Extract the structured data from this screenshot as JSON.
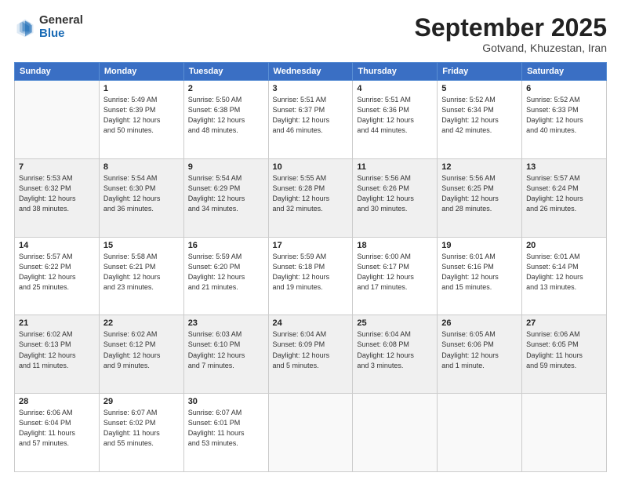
{
  "header": {
    "logo_general": "General",
    "logo_blue": "Blue",
    "title": "September 2025",
    "subtitle": "Gotvand, Khuzestan, Iran"
  },
  "weekdays": [
    "Sunday",
    "Monday",
    "Tuesday",
    "Wednesday",
    "Thursday",
    "Friday",
    "Saturday"
  ],
  "weeks": [
    [
      {
        "day": "",
        "info": ""
      },
      {
        "day": "1",
        "info": "Sunrise: 5:49 AM\nSunset: 6:39 PM\nDaylight: 12 hours\nand 50 minutes."
      },
      {
        "day": "2",
        "info": "Sunrise: 5:50 AM\nSunset: 6:38 PM\nDaylight: 12 hours\nand 48 minutes."
      },
      {
        "day": "3",
        "info": "Sunrise: 5:51 AM\nSunset: 6:37 PM\nDaylight: 12 hours\nand 46 minutes."
      },
      {
        "day": "4",
        "info": "Sunrise: 5:51 AM\nSunset: 6:36 PM\nDaylight: 12 hours\nand 44 minutes."
      },
      {
        "day": "5",
        "info": "Sunrise: 5:52 AM\nSunset: 6:34 PM\nDaylight: 12 hours\nand 42 minutes."
      },
      {
        "day": "6",
        "info": "Sunrise: 5:52 AM\nSunset: 6:33 PM\nDaylight: 12 hours\nand 40 minutes."
      }
    ],
    [
      {
        "day": "7",
        "info": "Sunrise: 5:53 AM\nSunset: 6:32 PM\nDaylight: 12 hours\nand 38 minutes."
      },
      {
        "day": "8",
        "info": "Sunrise: 5:54 AM\nSunset: 6:30 PM\nDaylight: 12 hours\nand 36 minutes."
      },
      {
        "day": "9",
        "info": "Sunrise: 5:54 AM\nSunset: 6:29 PM\nDaylight: 12 hours\nand 34 minutes."
      },
      {
        "day": "10",
        "info": "Sunrise: 5:55 AM\nSunset: 6:28 PM\nDaylight: 12 hours\nand 32 minutes."
      },
      {
        "day": "11",
        "info": "Sunrise: 5:56 AM\nSunset: 6:26 PM\nDaylight: 12 hours\nand 30 minutes."
      },
      {
        "day": "12",
        "info": "Sunrise: 5:56 AM\nSunset: 6:25 PM\nDaylight: 12 hours\nand 28 minutes."
      },
      {
        "day": "13",
        "info": "Sunrise: 5:57 AM\nSunset: 6:24 PM\nDaylight: 12 hours\nand 26 minutes."
      }
    ],
    [
      {
        "day": "14",
        "info": "Sunrise: 5:57 AM\nSunset: 6:22 PM\nDaylight: 12 hours\nand 25 minutes."
      },
      {
        "day": "15",
        "info": "Sunrise: 5:58 AM\nSunset: 6:21 PM\nDaylight: 12 hours\nand 23 minutes."
      },
      {
        "day": "16",
        "info": "Sunrise: 5:59 AM\nSunset: 6:20 PM\nDaylight: 12 hours\nand 21 minutes."
      },
      {
        "day": "17",
        "info": "Sunrise: 5:59 AM\nSunset: 6:18 PM\nDaylight: 12 hours\nand 19 minutes."
      },
      {
        "day": "18",
        "info": "Sunrise: 6:00 AM\nSunset: 6:17 PM\nDaylight: 12 hours\nand 17 minutes."
      },
      {
        "day": "19",
        "info": "Sunrise: 6:01 AM\nSunset: 6:16 PM\nDaylight: 12 hours\nand 15 minutes."
      },
      {
        "day": "20",
        "info": "Sunrise: 6:01 AM\nSunset: 6:14 PM\nDaylight: 12 hours\nand 13 minutes."
      }
    ],
    [
      {
        "day": "21",
        "info": "Sunrise: 6:02 AM\nSunset: 6:13 PM\nDaylight: 12 hours\nand 11 minutes."
      },
      {
        "day": "22",
        "info": "Sunrise: 6:02 AM\nSunset: 6:12 PM\nDaylight: 12 hours\nand 9 minutes."
      },
      {
        "day": "23",
        "info": "Sunrise: 6:03 AM\nSunset: 6:10 PM\nDaylight: 12 hours\nand 7 minutes."
      },
      {
        "day": "24",
        "info": "Sunrise: 6:04 AM\nSunset: 6:09 PM\nDaylight: 12 hours\nand 5 minutes."
      },
      {
        "day": "25",
        "info": "Sunrise: 6:04 AM\nSunset: 6:08 PM\nDaylight: 12 hours\nand 3 minutes."
      },
      {
        "day": "26",
        "info": "Sunrise: 6:05 AM\nSunset: 6:06 PM\nDaylight: 12 hours\nand 1 minute."
      },
      {
        "day": "27",
        "info": "Sunrise: 6:06 AM\nSunset: 6:05 PM\nDaylight: 11 hours\nand 59 minutes."
      }
    ],
    [
      {
        "day": "28",
        "info": "Sunrise: 6:06 AM\nSunset: 6:04 PM\nDaylight: 11 hours\nand 57 minutes."
      },
      {
        "day": "29",
        "info": "Sunrise: 6:07 AM\nSunset: 6:02 PM\nDaylight: 11 hours\nand 55 minutes."
      },
      {
        "day": "30",
        "info": "Sunrise: 6:07 AM\nSunset: 6:01 PM\nDaylight: 11 hours\nand 53 minutes."
      },
      {
        "day": "",
        "info": ""
      },
      {
        "day": "",
        "info": ""
      },
      {
        "day": "",
        "info": ""
      },
      {
        "day": "",
        "info": ""
      }
    ]
  ]
}
